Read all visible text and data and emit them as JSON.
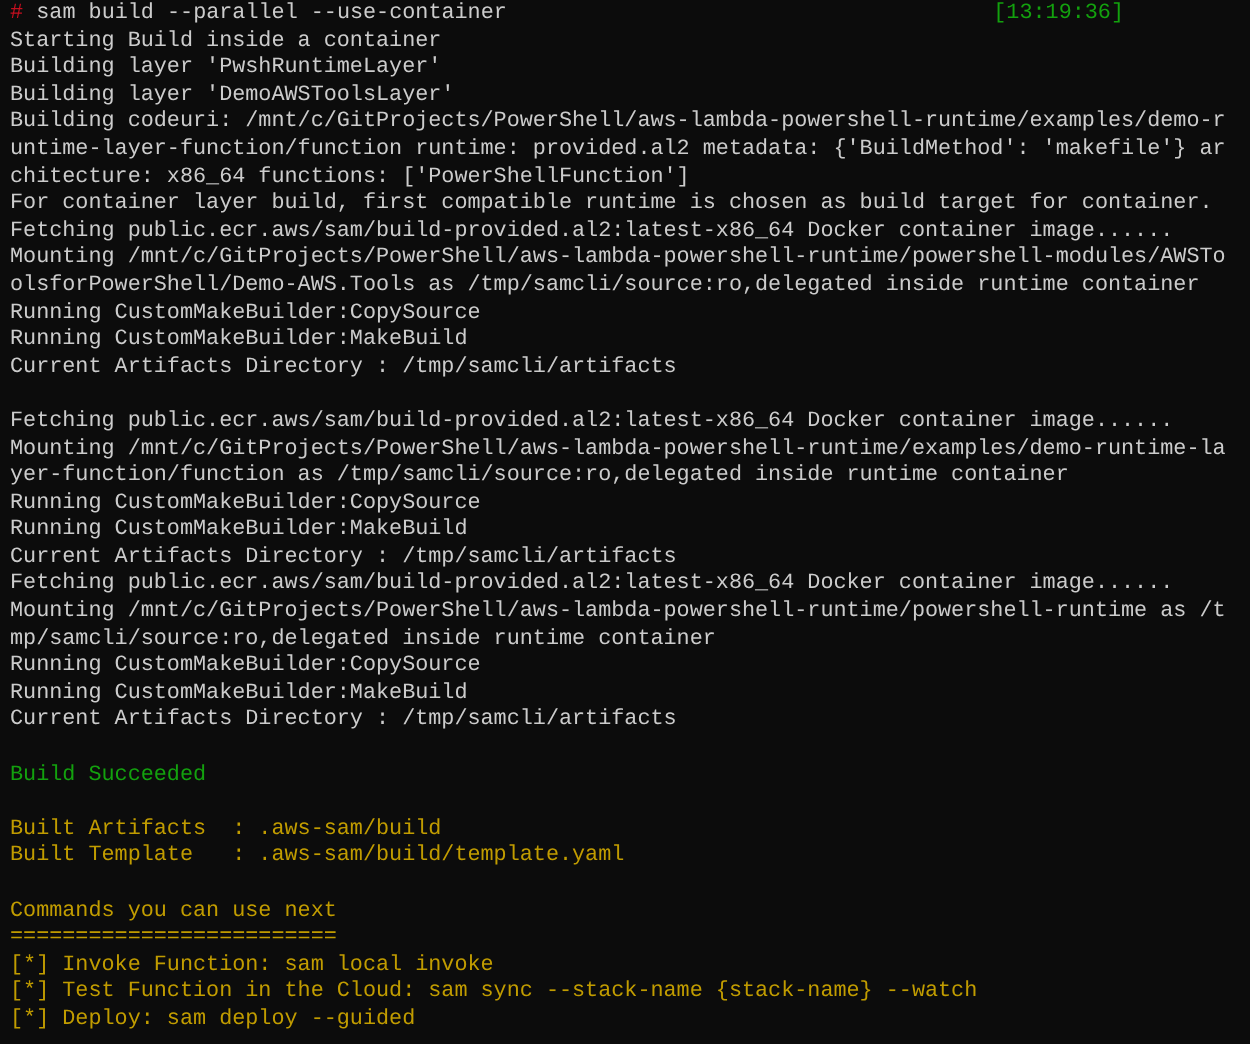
{
  "prompt": {
    "symbol": "#",
    "command": "sam build --parallel --use-container",
    "time": "[13:19:36]"
  },
  "lines": [
    {
      "kind": "output",
      "text": "Starting Build inside a container"
    },
    {
      "kind": "output",
      "text": "Building layer 'PwshRuntimeLayer'"
    },
    {
      "kind": "output",
      "text": "Building layer 'DemoAWSToolsLayer'"
    },
    {
      "kind": "output",
      "text": "Building codeuri: /mnt/c/GitProjects/PowerShell/aws-lambda-powershell-runtime/examples/demo-r"
    },
    {
      "kind": "output",
      "text": "untime-layer-function/function runtime: provided.al2 metadata: {'BuildMethod': 'makefile'} ar"
    },
    {
      "kind": "output",
      "text": "chitecture: x86_64 functions: ['PowerShellFunction']"
    },
    {
      "kind": "output",
      "text": "For container layer build, first compatible runtime is chosen as build target for container."
    },
    {
      "kind": "output",
      "text": "Fetching public.ecr.aws/sam/build-provided.al2:latest-x86_64 Docker container image......"
    },
    {
      "kind": "output",
      "text": "Mounting /mnt/c/GitProjects/PowerShell/aws-lambda-powershell-runtime/powershell-modules/AWSTo"
    },
    {
      "kind": "output",
      "text": "olsforPowerShell/Demo-AWS.Tools as /tmp/samcli/source:ro,delegated inside runtime container"
    },
    {
      "kind": "output",
      "text": "Running CustomMakeBuilder:CopySource"
    },
    {
      "kind": "output",
      "text": "Running CustomMakeBuilder:MakeBuild"
    },
    {
      "kind": "output",
      "text": "Current Artifacts Directory : /tmp/samcli/artifacts"
    },
    {
      "kind": "blank"
    },
    {
      "kind": "output",
      "text": "Fetching public.ecr.aws/sam/build-provided.al2:latest-x86_64 Docker container image......"
    },
    {
      "kind": "output",
      "text": "Mounting /mnt/c/GitProjects/PowerShell/aws-lambda-powershell-runtime/examples/demo-runtime-la"
    },
    {
      "kind": "output",
      "text": "yer-function/function as /tmp/samcli/source:ro,delegated inside runtime container"
    },
    {
      "kind": "output",
      "text": "Running CustomMakeBuilder:CopySource"
    },
    {
      "kind": "output",
      "text": "Running CustomMakeBuilder:MakeBuild"
    },
    {
      "kind": "output",
      "text": "Current Artifacts Directory : /tmp/samcli/artifacts"
    },
    {
      "kind": "output",
      "text": "Fetching public.ecr.aws/sam/build-provided.al2:latest-x86_64 Docker container image......"
    },
    {
      "kind": "output",
      "text": "Mounting /mnt/c/GitProjects/PowerShell/aws-lambda-powershell-runtime/powershell-runtime as /t"
    },
    {
      "kind": "output",
      "text": "mp/samcli/source:ro,delegated inside runtime container"
    },
    {
      "kind": "output",
      "text": "Running CustomMakeBuilder:CopySource"
    },
    {
      "kind": "output",
      "text": "Running CustomMakeBuilder:MakeBuild"
    },
    {
      "kind": "output",
      "text": "Current Artifacts Directory : /tmp/samcli/artifacts"
    },
    {
      "kind": "blank"
    },
    {
      "kind": "success",
      "text": "Build Succeeded"
    },
    {
      "kind": "blank"
    },
    {
      "kind": "info",
      "text": "Built Artifacts  : .aws-sam/build"
    },
    {
      "kind": "info",
      "text": "Built Template   : .aws-sam/build/template.yaml"
    },
    {
      "kind": "blank"
    },
    {
      "kind": "info",
      "text": "Commands you can use next"
    },
    {
      "kind": "info",
      "text": "========================="
    },
    {
      "kind": "info",
      "text": "[*] Invoke Function: sam local invoke"
    },
    {
      "kind": "info",
      "text": "[*] Test Function in the Cloud: sam sync --stack-name {stack-name} --watch"
    },
    {
      "kind": "info",
      "text": "[*] Deploy: sam deploy --guided"
    }
  ]
}
